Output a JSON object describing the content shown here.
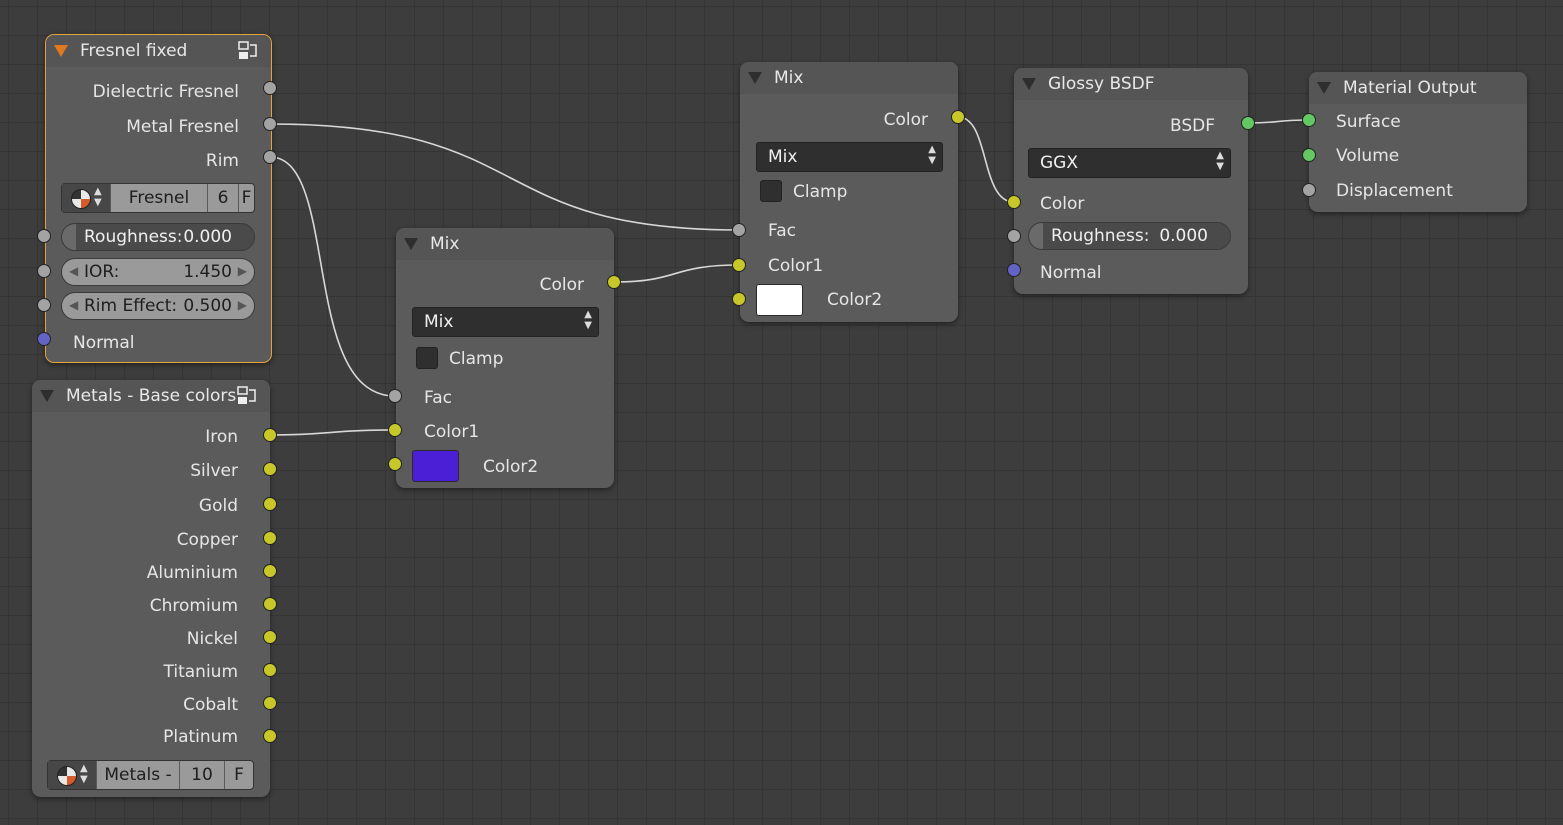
{
  "colors": {
    "background": "#3d3d3d",
    "node_body": "#5b5b5b",
    "selected_outline": "#e8a23a",
    "socket_float": "#a3a3a3",
    "socket_color": "#c7c729",
    "socket_vector": "#6363c7",
    "socket_shader": "#63c763",
    "wire": "#d8d8d8"
  },
  "fresnel_node": {
    "title": "Fresnel fixed",
    "icon": "node-group-icon",
    "outputs": [
      "Dielectric Fresnel",
      "Metal Fresnel",
      "Rim"
    ],
    "group_selector": {
      "name": "Fresnel",
      "users": "6",
      "fake_user": "F"
    },
    "inputs": {
      "roughness": {
        "label": "Roughness:",
        "value": "0.000"
      },
      "ior": {
        "label": "IOR:",
        "value": "1.450"
      },
      "rim_effect": {
        "label": "Rim Effect:",
        "value": "0.500"
      },
      "normal": "Normal"
    }
  },
  "metals_node": {
    "title": "Metals - Base colors",
    "icon": "node-group-icon",
    "outputs": [
      "Iron",
      "Silver",
      "Gold",
      "Copper",
      "Aluminium",
      "Chromium",
      "Nickel",
      "Titanium",
      "Cobalt",
      "Platinum"
    ],
    "group_selector": {
      "name": "Metals -",
      "users": "10",
      "fake_user": "F"
    }
  },
  "mix_node_1": {
    "title": "Mix",
    "output": "Color",
    "blend_mode": "Mix",
    "clamp": "Clamp",
    "inputs": {
      "fac": "Fac",
      "color1": "Color1",
      "color2": "Color2"
    },
    "color2_swatch": "#4a1fd6"
  },
  "mix_node_2": {
    "title": "Mix",
    "output": "Color",
    "blend_mode": "Mix",
    "clamp": "Clamp",
    "inputs": {
      "fac": "Fac",
      "color1": "Color1",
      "color2": "Color2"
    },
    "color2_swatch": "#ffffff"
  },
  "glossy_node": {
    "title": "Glossy BSDF",
    "output": "BSDF",
    "distribution": "GGX",
    "inputs": {
      "color": "Color",
      "roughness": {
        "label": "Roughness:",
        "value": "0.000"
      },
      "normal": "Normal"
    }
  },
  "output_node": {
    "title": "Material Output",
    "inputs": [
      "Surface",
      "Volume",
      "Displacement"
    ]
  }
}
